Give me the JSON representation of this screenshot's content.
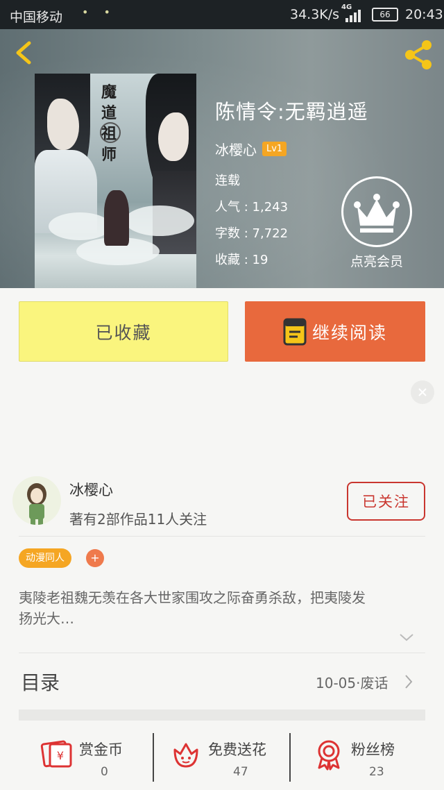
{
  "status_bar": {
    "carrier": "中国移动",
    "speed": "34.3K/s",
    "network": "4G",
    "battery": "66",
    "time": "20:43"
  },
  "book": {
    "title": "陈情令:无羁逍遥",
    "author": "冰樱心",
    "author_level": "Lv1",
    "status": "连载",
    "popularity_label": "人气",
    "popularity": "1,243",
    "wordcount_label": "字数",
    "wordcount": "7,722",
    "favorites_label": "收藏",
    "favorites": "19",
    "cover_title": "魔道祖师"
  },
  "vip": {
    "label": "点亮会员"
  },
  "actions": {
    "collect_label": "已收藏",
    "read_label": "继续阅读"
  },
  "author_card": {
    "name": "冰樱心",
    "meta": "著有2部作品11人关注",
    "follow_label": "已关注"
  },
  "tags": [
    "动漫同人"
  ],
  "tag_add": "+",
  "description": "夷陵老祖魏无羡在各大世家围攻之际奋勇杀敌，把夷陵发扬光大…",
  "toc": {
    "label": "目录",
    "latest_date": "10-05",
    "latest_title": "废话"
  },
  "bottom_bar": [
    {
      "label": "赏金币",
      "count": "0",
      "icon": "coin-envelope-icon"
    },
    {
      "label": "免费送花",
      "count": "47",
      "icon": "flower-icon"
    },
    {
      "label": "粉丝榜",
      "count": "23",
      "icon": "medal-icon"
    }
  ],
  "colors": {
    "accent_orange": "#e8693d",
    "collect_yellow": "#faf57e",
    "badge_orange": "#f5a623",
    "follow_red": "#c9362f"
  }
}
